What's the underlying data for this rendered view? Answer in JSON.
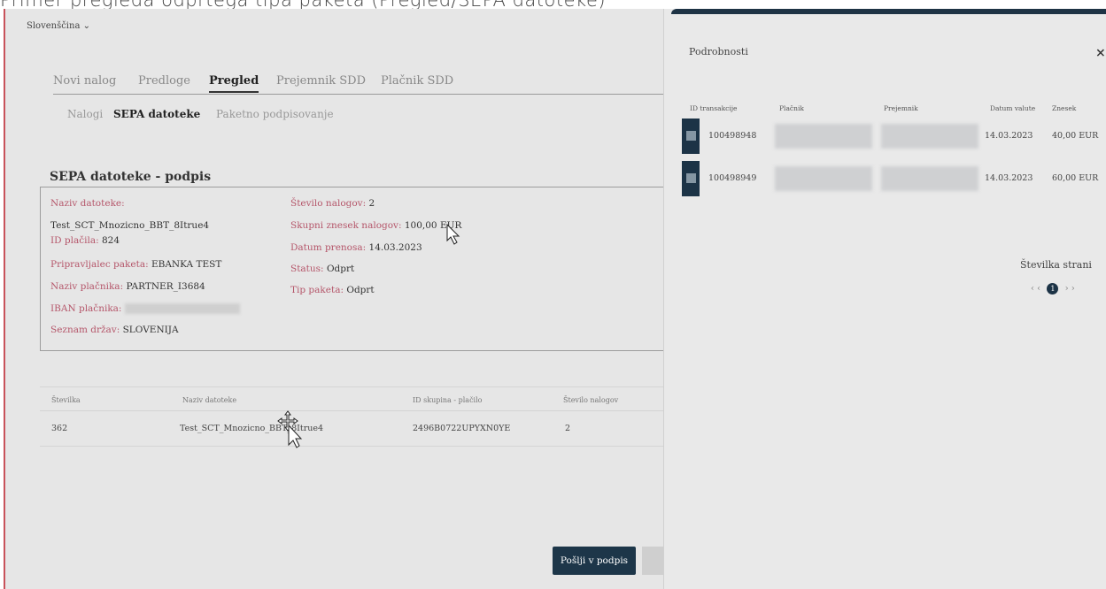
{
  "caption": "Primer pregleda odprtega tipa paketa (Pregled/SEPA datoteke)",
  "language_selector": "Slovenščina ⌄",
  "tabs": [
    "Novi nalog",
    "Predloge",
    "Pregled",
    "Prejemnik SDD",
    "Plačnik SDD"
  ],
  "active_tab": "Pregled",
  "subtabs": [
    "Nalogi",
    "SEPA datoteke",
    "Paketno podpisovanje"
  ],
  "section_title": "SEPA datoteke - podpis",
  "info": {
    "file_name_label": "Naziv datoteke:",
    "file_name_value": "Test_SCT_Mnozicno_BBT_8Itrue4",
    "payment_id_label": "ID plačila:",
    "payment_id_value": "824",
    "preparer_label": "Pripravljalec paketa:",
    "preparer_value": "EBANKA TEST",
    "payer_name_label": "Naziv plačnika:",
    "payer_name_value": "PARTNER_I3684",
    "iban_label": "IBAN plačnika:",
    "country_label": "Seznam držav:",
    "country_value": "SLOVENIJA",
    "order_count_label": "Število nalogov:",
    "order_count_value": "2",
    "total_label": "Skupni znesek nalogov:",
    "total_value": "100,00 EUR",
    "transfer_date_label": "Datum prenosa:",
    "transfer_date_value": "14.03.2023",
    "status_label": "Status:",
    "status_value": "Odprt",
    "package_type_label": "Tip paketa:",
    "package_type_value": "Odprt"
  },
  "table": {
    "headers": [
      "Številka",
      "Naziv datoteke",
      "ID skupina - plačilo",
      "Število nalogov"
    ],
    "row": [
      "362",
      "Test_SCT_Mnozicno_BBT_8Itrue4",
      "2496B0722UPYXN0YE",
      "2"
    ]
  },
  "send_button": "Pošlji v podpis",
  "panel": {
    "title": "Podrobnosti",
    "close": "×",
    "headers": [
      "ID transakcije",
      "Plačnik",
      "Prejemnik",
      "Datum valute",
      "Znesek"
    ],
    "rows": [
      {
        "id": "100498948",
        "date": "14.03.2023",
        "amount": "40,00 EUR"
      },
      {
        "id": "100498949",
        "date": "14.03.2023",
        "amount": "60,00 EUR"
      }
    ],
    "pager_label": "Številka strani",
    "pager_current": "1",
    "pager_prev": "‹ ‹",
    "pager_next": "› ›"
  },
  "colors": {
    "navy": "#1d3649",
    "label_red": "#b5566a",
    "background": "#e6e6e6"
  }
}
